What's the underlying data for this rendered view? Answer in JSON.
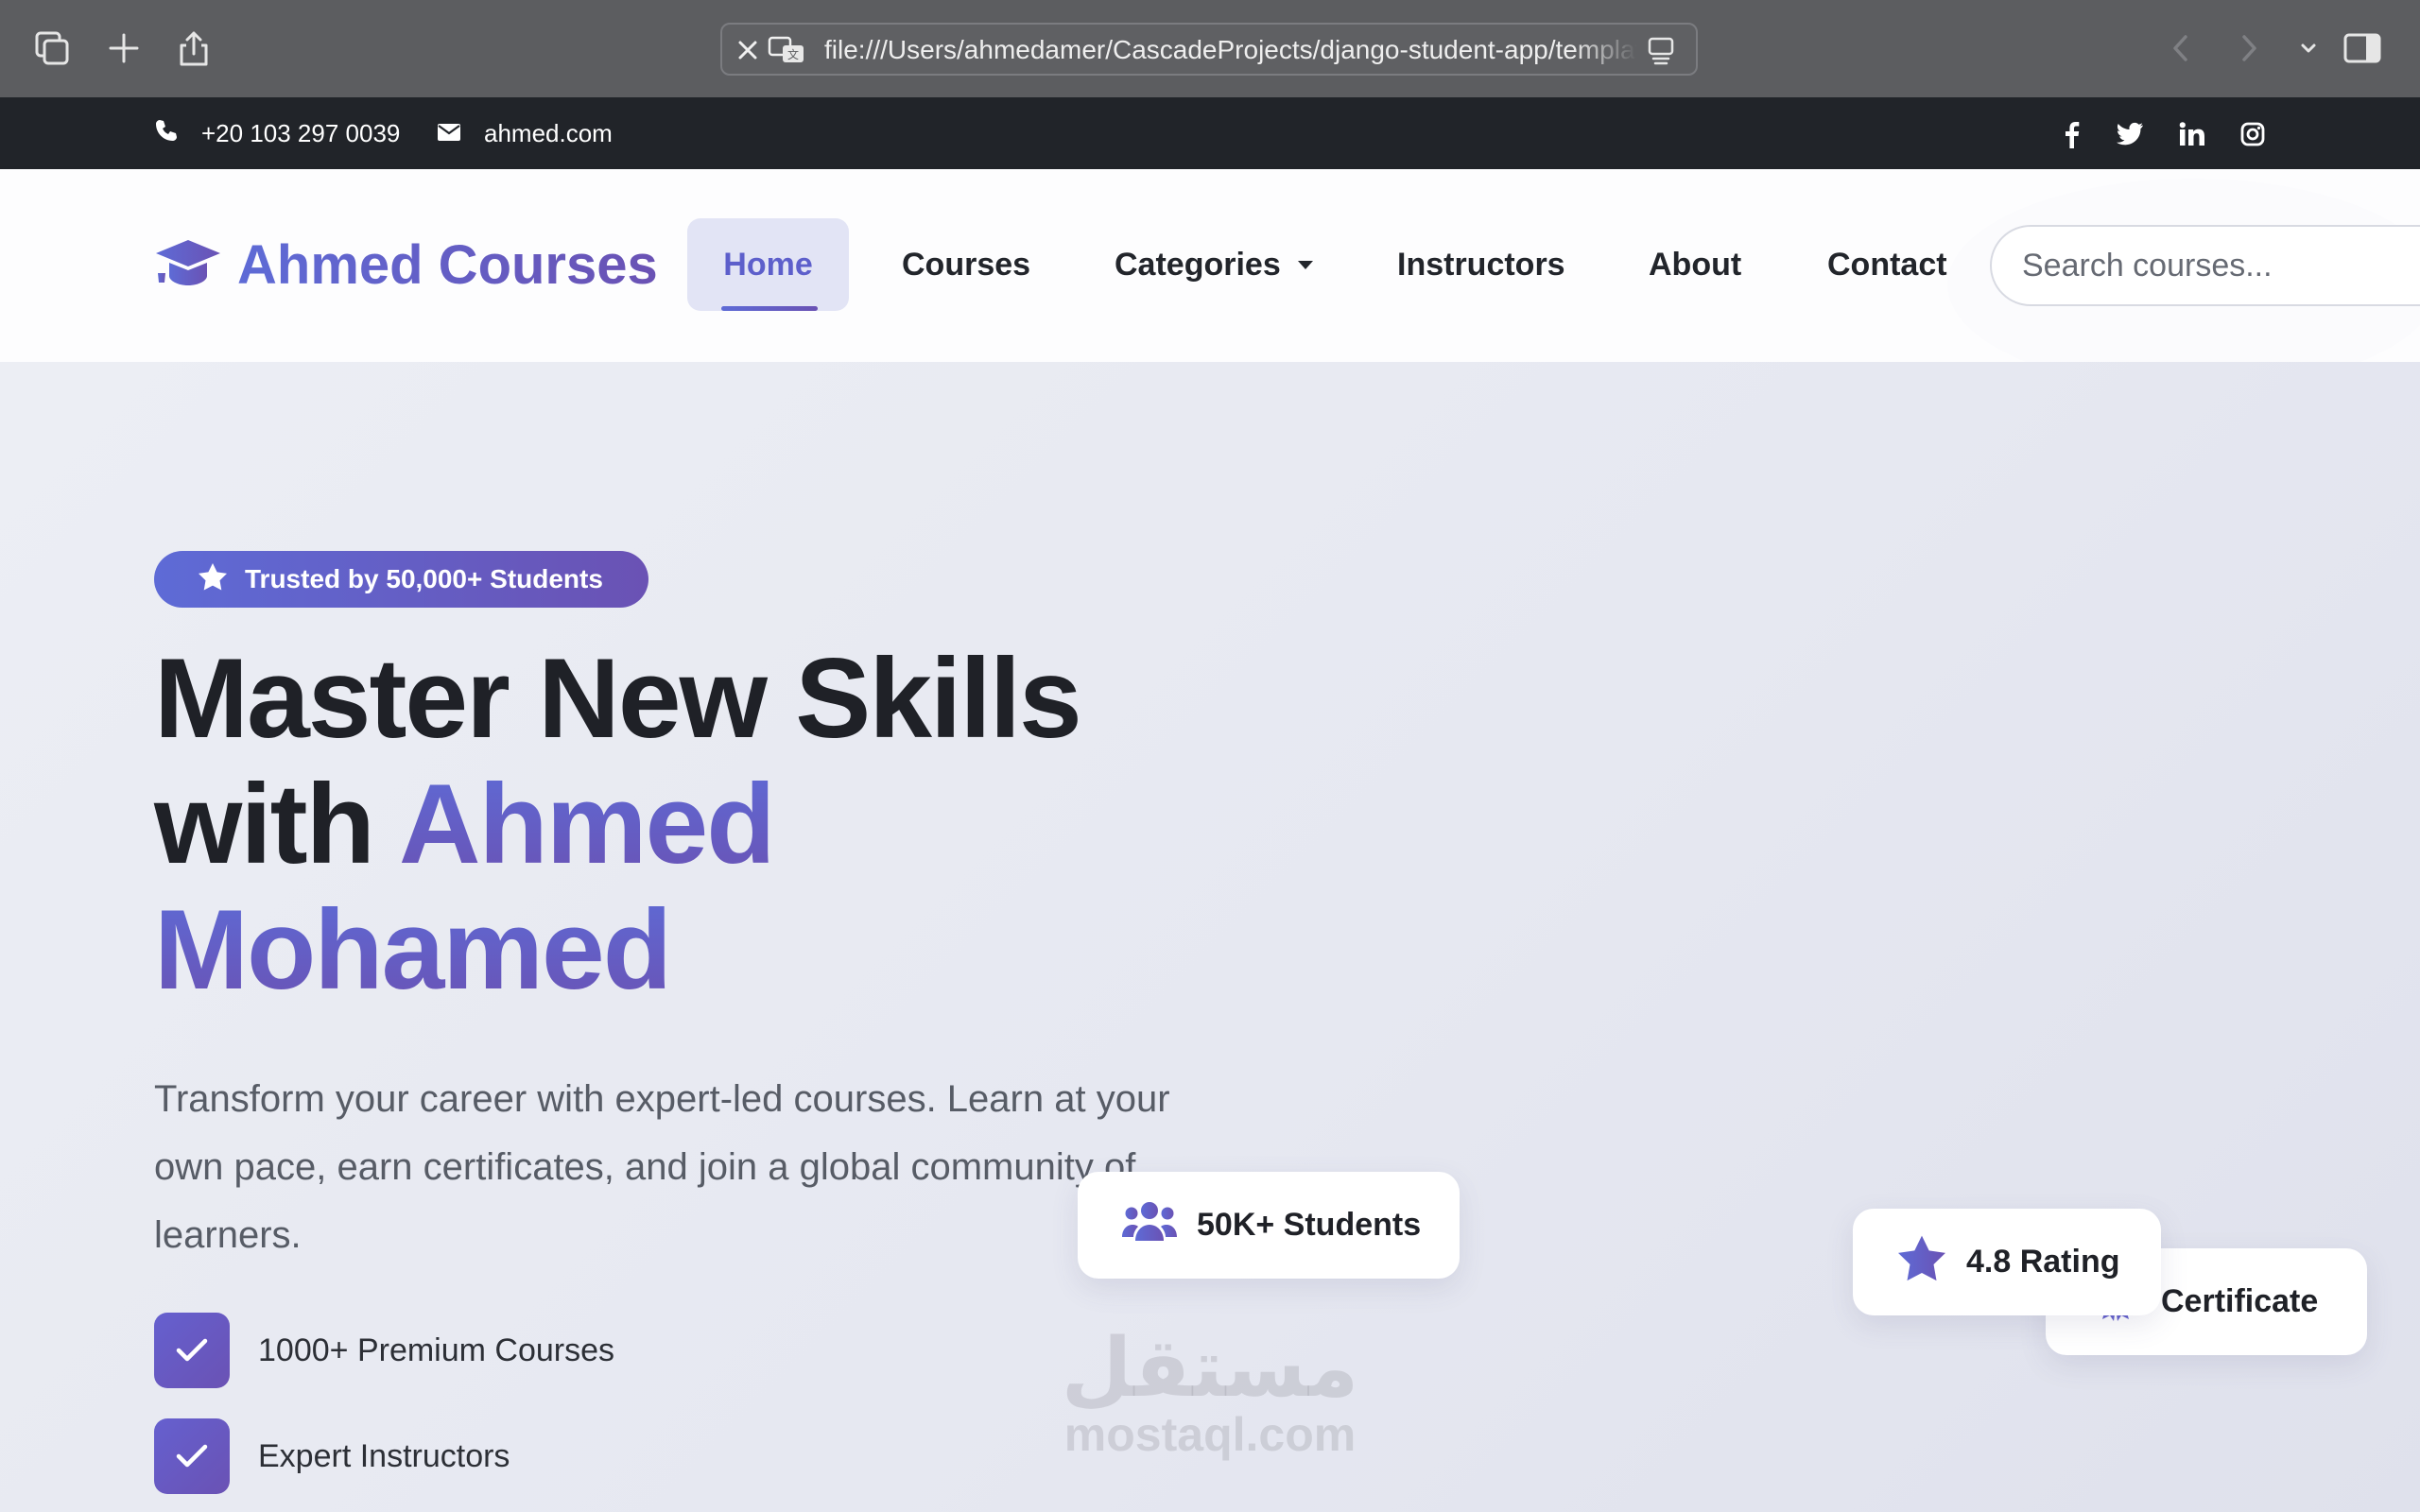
{
  "browser": {
    "url": "file:///Users/ahmedamer/CascadeProjects/django-student-app/templates/index.html"
  },
  "topbar": {
    "phone": "+20 103 297 0039",
    "email": "ahmed.com",
    "social": [
      "facebook-icon",
      "twitter-icon",
      "linkedin-icon",
      "instagram-icon"
    ]
  },
  "navbar": {
    "brand": "Ahmed Courses",
    "links": {
      "home": "Home",
      "courses": "Courses",
      "categories": "Categories",
      "instructors": "Instructors",
      "about": "About",
      "contact": "Contact"
    },
    "search_placeholder": "Search courses..."
  },
  "hero": {
    "badge": "Trusted by 50,000+ Students",
    "headline_line1": "Master New Skills",
    "headline_with": "with",
    "headline_name_first": "Ahmed",
    "headline_name_last": "Mohamed",
    "subtitle": "Transform your career with expert-led courses. Learn at your own pace, earn certificates, and join a global community of learners.",
    "features": [
      "1000+ Premium Courses",
      "Expert Instructors"
    ],
    "cards": {
      "students": "50K+ Students",
      "rating": "4.8 Rating",
      "certificate": "Certificate"
    }
  },
  "watermark": {
    "arabic": "مستقل",
    "latin": "mostaql.com"
  },
  "colors": {
    "accent_start": "#5e6bd6",
    "accent_end": "#6a52b4",
    "topbar_bg": "#212429",
    "heading": "#1f2127"
  }
}
